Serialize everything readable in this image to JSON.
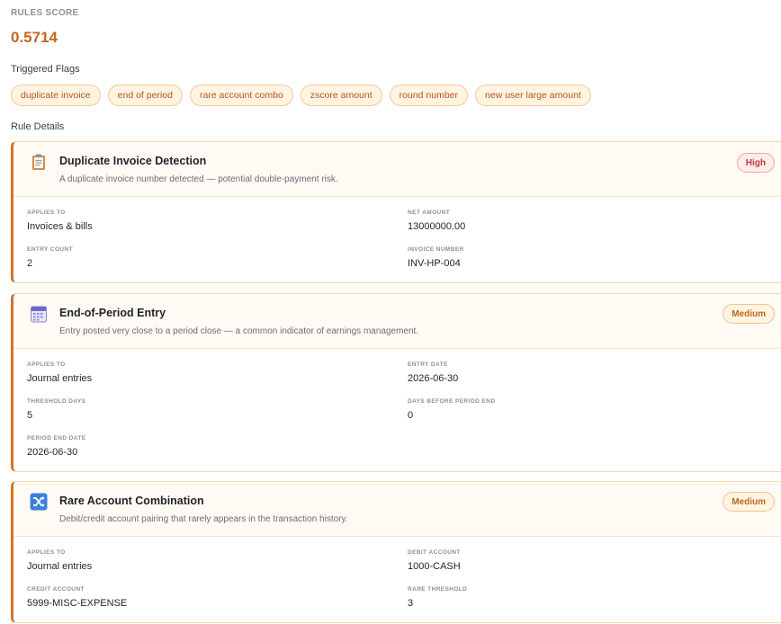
{
  "rules_score": {
    "label": "RULES SCORE",
    "value": "0.5714"
  },
  "triggered_flags": {
    "label": "Triggered Flags",
    "items": [
      "duplicate invoice",
      "end of period",
      "rare account combo",
      "zscore amount",
      "round number",
      "new user large amount"
    ]
  },
  "rule_details": {
    "label": "Rule Details",
    "rules": [
      {
        "icon": "clipboard-icon",
        "title": "Duplicate Invoice Detection",
        "description": "A duplicate invoice number detected — potential double-payment risk.",
        "severity": "High",
        "fields": [
          {
            "label": "APPLIES TO",
            "value": "Invoices & bills"
          },
          {
            "label": "NET AMOUNT",
            "value": "13000000.00"
          },
          {
            "label": "ENTRY COUNT",
            "value": "2"
          },
          {
            "label": "INVOICE NUMBER",
            "value": "INV-HP-004"
          }
        ]
      },
      {
        "icon": "calendar-icon",
        "title": "End-of-Period Entry",
        "description": "Entry posted very close to a period close — a common indicator of earnings management.",
        "severity": "Medium",
        "fields": [
          {
            "label": "APPLIES TO",
            "value": "Journal entries"
          },
          {
            "label": "ENTRY DATE",
            "value": "2026-06-30"
          },
          {
            "label": "THRESHOLD DAYS",
            "value": "5"
          },
          {
            "label": "DAYS BEFORE PERIOD END",
            "value": "0"
          },
          {
            "label": "PERIOD END DATE",
            "value": "2026-06-30"
          }
        ]
      },
      {
        "icon": "shuffle-icon",
        "title": "Rare Account Combination",
        "description": "Debit/credit account pairing that rarely appears in the transaction history.",
        "severity": "Medium",
        "fields": [
          {
            "label": "APPLIES TO",
            "value": "Journal entries"
          },
          {
            "label": "DEBIT ACCOUNT",
            "value": "1000-CASH"
          },
          {
            "label": "CREDIT ACCOUNT",
            "value": "5999-MISC-EXPENSE"
          },
          {
            "label": "RARE THRESHOLD",
            "value": "3"
          }
        ]
      }
    ]
  }
}
